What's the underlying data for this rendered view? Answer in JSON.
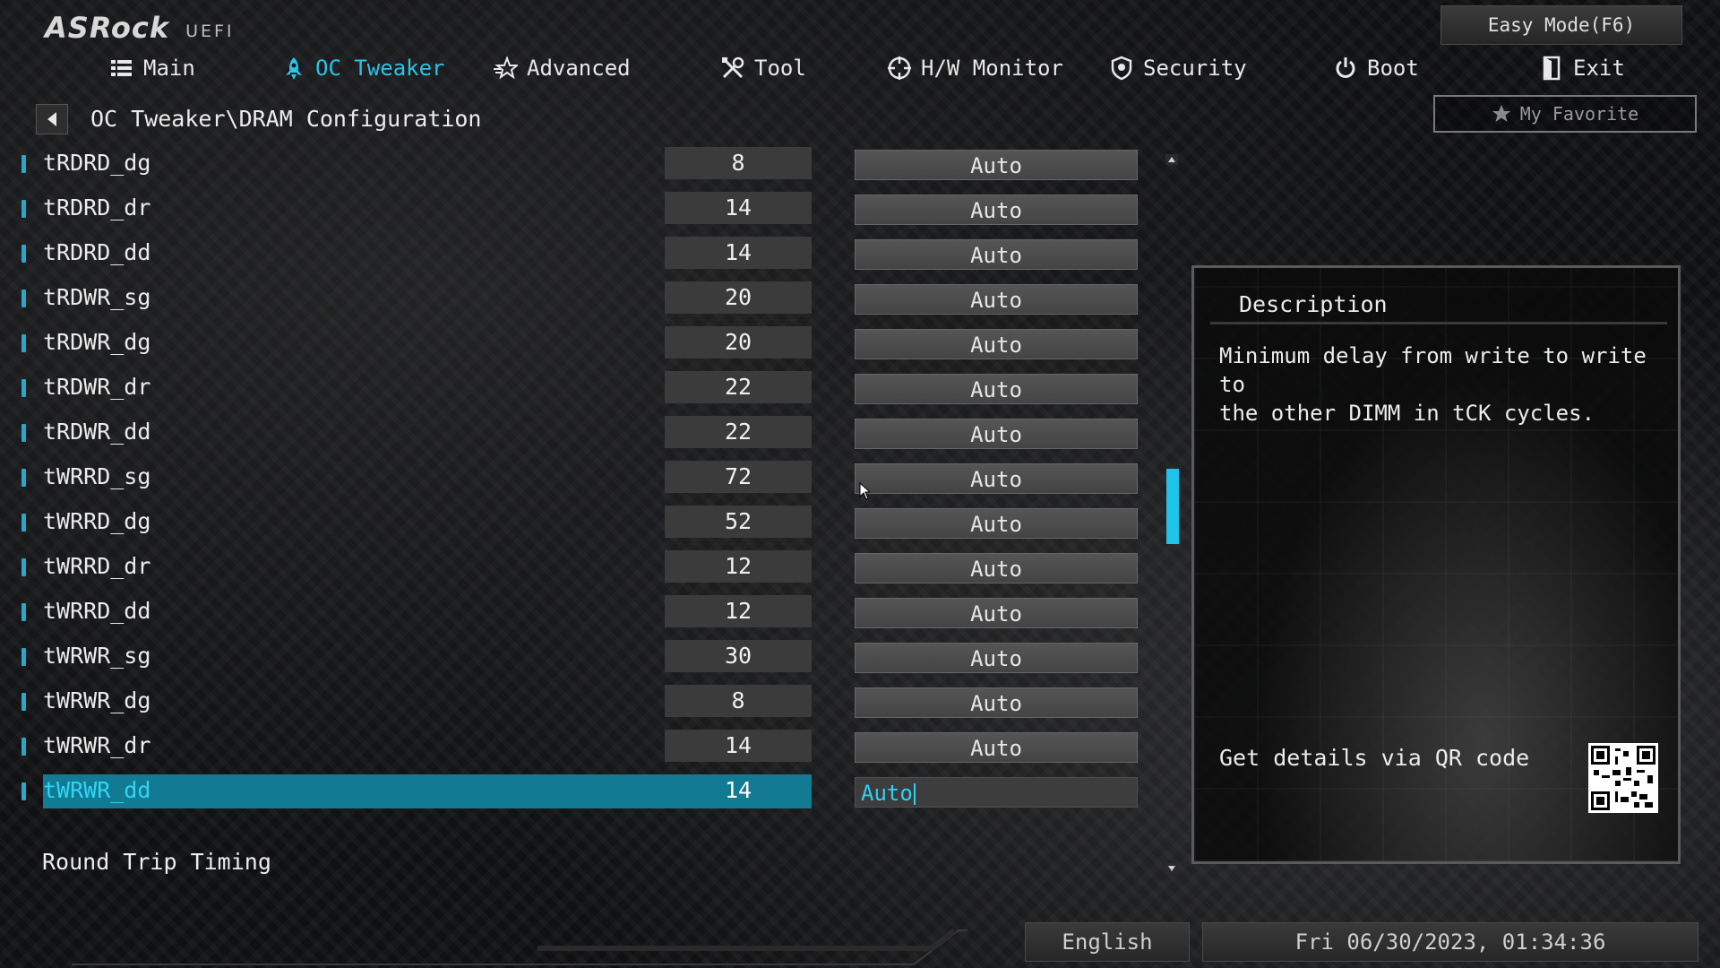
{
  "header": {
    "logo": "ASRock",
    "logo_sub": "UEFI",
    "easy_mode_label": "Easy Mode(F6)",
    "my_favorite_label": "My Favorite"
  },
  "nav": {
    "active_color": "#2cc3e8",
    "tabs": [
      {
        "label": "Main",
        "icon": "list-icon"
      },
      {
        "label": "OC Tweaker",
        "icon": "rocket-icon"
      },
      {
        "label": "Advanced",
        "icon": "star-icon"
      },
      {
        "label": "Tool",
        "icon": "tools-icon"
      },
      {
        "label": "H/W Monitor",
        "icon": "crosshair-icon"
      },
      {
        "label": "Security",
        "icon": "shield-icon"
      },
      {
        "label": "Boot",
        "icon": "power-icon"
      },
      {
        "label": "Exit",
        "icon": "exit-door-icon"
      }
    ],
    "active_tab": "OC Tweaker"
  },
  "breadcrumb": "OC Tweaker\\DRAM Configuration",
  "timings": [
    {
      "name": "tRDRD_dg",
      "current": "8",
      "setting": "Auto"
    },
    {
      "name": "tRDRD_dr",
      "current": "14",
      "setting": "Auto"
    },
    {
      "name": "tRDRD_dd",
      "current": "14",
      "setting": "Auto"
    },
    {
      "name": "tRDWR_sg",
      "current": "20",
      "setting": "Auto"
    },
    {
      "name": "tRDWR_dg",
      "current": "20",
      "setting": "Auto"
    },
    {
      "name": "tRDWR_dr",
      "current": "22",
      "setting": "Auto"
    },
    {
      "name": "tRDWR_dd",
      "current": "22",
      "setting": "Auto"
    },
    {
      "name": "tWRRD_sg",
      "current": "72",
      "setting": "Auto"
    },
    {
      "name": "tWRRD_dg",
      "current": "52",
      "setting": "Auto"
    },
    {
      "name": "tWRRD_dr",
      "current": "12",
      "setting": "Auto"
    },
    {
      "name": "tWRRD_dd",
      "current": "12",
      "setting": "Auto"
    },
    {
      "name": "tWRWR_sg",
      "current": "30",
      "setting": "Auto"
    },
    {
      "name": "tWRWR_dg",
      "current": "8",
      "setting": "Auto"
    },
    {
      "name": "tWRWR_dr",
      "current": "14",
      "setting": "Auto"
    },
    {
      "name": "tWRWR_dd",
      "current": "14",
      "setting": "Auto"
    }
  ],
  "selected_row": "tWRWR_dd",
  "section_label": "Round Trip Timing",
  "description": {
    "title": "Description",
    "text": "Minimum delay from write to write to\nthe other DIMM in tCK cycles.",
    "qr_label": "Get details via QR code"
  },
  "footer": {
    "language": "English",
    "datetime": "Fri 06/30/2023, 01:34:36"
  }
}
